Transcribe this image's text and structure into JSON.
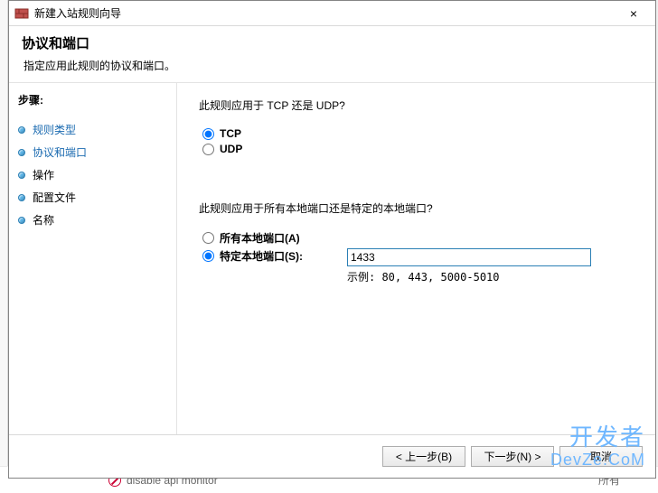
{
  "window": {
    "title": "新建入站规则向导",
    "close": "×"
  },
  "header": {
    "title": "协议和端口",
    "subtitle": "指定应用此规则的协议和端口。"
  },
  "sidebar": {
    "steps_label": "步骤:",
    "items": [
      {
        "label": "规则类型",
        "state": "done"
      },
      {
        "label": "协议和端口",
        "state": "current"
      },
      {
        "label": "操作",
        "state": "pending"
      },
      {
        "label": "配置文件",
        "state": "pending"
      },
      {
        "label": "名称",
        "state": "pending"
      }
    ]
  },
  "content": {
    "q1": "此规则应用于 TCP 还是 UDP?",
    "protocol_tcp": "TCP",
    "protocol_udp": "UDP",
    "protocol_selected": "tcp",
    "q2": "此规则应用于所有本地端口还是特定的本地端口?",
    "all_ports_label": "所有本地端口(A)",
    "specific_ports_label": "特定本地端口(S):",
    "ports_selected": "specific",
    "port_value": "1433",
    "port_example": "示例: 80, 443, 5000-5010"
  },
  "footer": {
    "back": "< 上一步(B)",
    "next": "下一步(N) >",
    "cancel": "取消"
  },
  "background_row": {
    "text": "disable api monitor",
    "col2": "所有"
  },
  "watermark": {
    "cn": "开发者",
    "en": "DevZe.CoM"
  }
}
